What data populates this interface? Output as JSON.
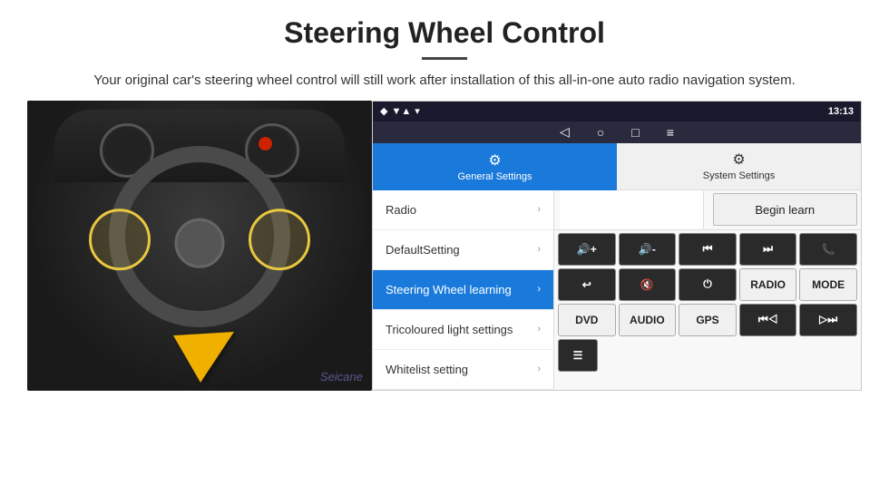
{
  "header": {
    "title": "Steering Wheel Control",
    "subtitle": "Your original car's steering wheel control will still work after installation of this all-in-one auto radio navigation system."
  },
  "status_bar": {
    "time": "13:13",
    "signal_icon": "▼▲",
    "wifi_icon": "▾",
    "gps_icon": "◆"
  },
  "nav_bar": {
    "back_icon": "◁",
    "home_icon": "○",
    "recent_icon": "□",
    "menu_icon": "≡"
  },
  "tabs": {
    "general": {
      "label": "General Settings",
      "icon": "⚙"
    },
    "system": {
      "label": "System Settings",
      "icon": "⚙"
    }
  },
  "menu_items": [
    {
      "label": "Radio",
      "active": false
    },
    {
      "label": "DefaultSetting",
      "active": false
    },
    {
      "label": "Steering Wheel learning",
      "active": true
    },
    {
      "label": "Tricoloured light settings",
      "active": false
    },
    {
      "label": "Whitelist setting",
      "active": false
    }
  ],
  "right_panel": {
    "begin_learn_label": "Begin learn",
    "controls": [
      [
        "vol+",
        "vol-",
        "prev",
        "next",
        "phone"
      ],
      [
        "call",
        "mute",
        "power",
        "RADIO",
        "MODE"
      ],
      [
        "DVD",
        "AUDIO",
        "GPS",
        "prev2",
        "next2"
      ],
      [
        "menu"
      ]
    ]
  },
  "watermark": "Seicane"
}
